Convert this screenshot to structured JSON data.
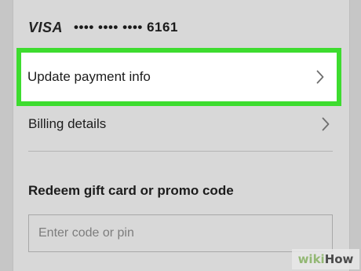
{
  "payment_method": {
    "brand": "VISA",
    "masked_number": "•••• •••• •••• 6161"
  },
  "menu": {
    "update_payment_label": "Update payment info",
    "billing_details_label": "Billing details"
  },
  "promo": {
    "title": "Redeem gift card or promo code",
    "placeholder": "Enter code or pin",
    "value": ""
  },
  "watermark": {
    "wiki": "wiki",
    "how": "How"
  },
  "colors": {
    "highlight": "#3ddc2f",
    "background": "#d8d8d8",
    "row_highlight_bg": "#ffffff"
  },
  "icons": {
    "chevron": "chevron-right-icon"
  }
}
